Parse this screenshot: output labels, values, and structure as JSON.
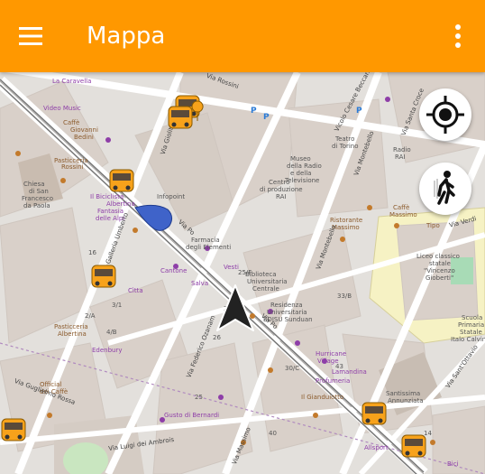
{
  "app": {
    "title": "Mappa"
  },
  "icons": {
    "menu": "menu-icon",
    "overflow": "more-vert-icon",
    "locate": "my-location-icon",
    "walk": "walking-person-icon",
    "navigation": "navigation-arrow-icon",
    "bus": "bus-stop-icon",
    "pointer": "map-pointer-icon"
  },
  "colors": {
    "appbar": "#ff9800",
    "bus": "#f7a21b",
    "pointer": "#3f63c9"
  },
  "map": {
    "labels": [
      "La Caravella",
      "Video Music",
      "Caffè",
      "Pasticceria",
      "Rossini",
      "Giovanni",
      "Bedini",
      "Chiesa",
      "di San",
      "Francesco",
      "da Paola",
      "Centro",
      "di produzione",
      "RAI",
      "Museo",
      "della Radio",
      "e della",
      "Televisione",
      "Teatro",
      "di Torino",
      "Radio",
      "RAI",
      "Ristorante",
      "Massimo",
      "Caffè",
      "Massimo",
      "Tipo",
      "Liceo classico",
      "statale",
      "\"Vincenzo",
      "Gioberti\"",
      "Biblioteca",
      "Universitaria",
      "Centrale",
      "Residenza",
      "Universitaria",
      "EDISU Sunduan",
      "Farmacia",
      "degli Elementi",
      "Infopoint",
      "Albertina",
      "Il Biciclista",
      "Fantasia",
      "delle Alpi",
      "Cantone",
      "Salva",
      "Vesti",
      "Cìtta",
      "Pasticceria",
      "Albertina",
      "Edenbury",
      "Official",
      "dei Caffè",
      "Gusto di Bernardi",
      "Profumeria",
      "Il Gianduiotto",
      "Hurricane",
      "Village",
      "Lamandina",
      "Santissima",
      "Annunziata",
      "Scuola",
      "Primaria",
      "Statale",
      "Italo Calvino",
      "Allsport",
      "Bici",
      "Via Po",
      "Via Po",
      "Via Giolitti",
      "Via Montebello",
      "Via Montebello",
      "Via Federico Ozanam",
      "Via Santa Croce",
      "Via Guglielmo Rossa",
      "Via Massimo",
      "Via Luigi dei Ambrois",
      "Via Sant'Ottavio",
      "Via Verdi",
      "Vicolo Cesare Beccaria",
      "Via Rossini",
      "Galleria Umberto",
      "P",
      "P",
      "P",
      "29",
      "16",
      "3/1",
      "25/F",
      "33/B",
      "40",
      "30/C",
      "26",
      "43",
      "14",
      "25",
      "2/A",
      "4/B"
    ]
  }
}
